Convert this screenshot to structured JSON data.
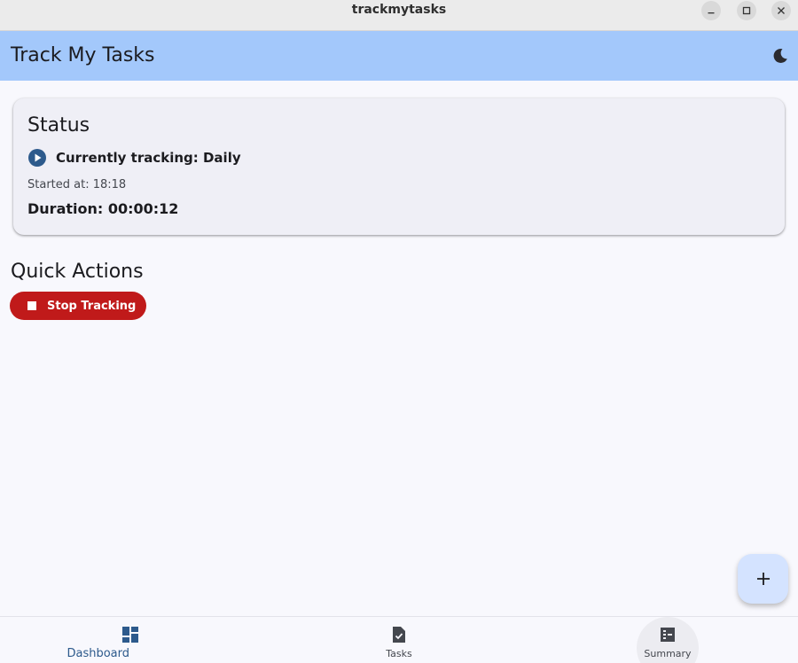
{
  "window": {
    "title": "trackmytasks"
  },
  "appbar": {
    "title": "Track My Tasks",
    "theme_icon": "moon-icon"
  },
  "status": {
    "title": "Status",
    "tracking": "Currently tracking: Daily",
    "started": "Started at: 18:18",
    "duration": "Duration: 00:00:12"
  },
  "quick_actions": {
    "title": "Quick Actions",
    "stop_label": "Stop Tracking",
    "stop_color": "#c01a1a"
  },
  "fab": {
    "icon": "plus-icon"
  },
  "nav": {
    "items": [
      {
        "label": "Dashboard",
        "icon": "dashboard-icon",
        "active": true
      },
      {
        "label": "Tasks",
        "icon": "task-check-icon",
        "active": false
      },
      {
        "label": "Summary",
        "icon": "summary-icon",
        "active": false
      }
    ]
  },
  "colors": {
    "appbar": "#a3c8fb",
    "accent": "#2d5a8c",
    "background": "#f8f8fd"
  }
}
